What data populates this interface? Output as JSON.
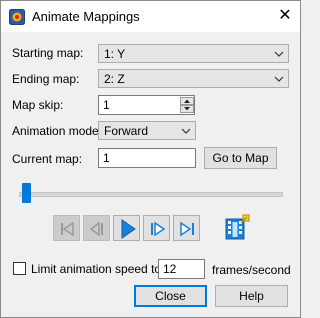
{
  "window": {
    "title": "Animate Mappings",
    "close_glyph": "✕",
    "app_icon": "tecplot-app-icon"
  },
  "form": {
    "starting_map_label": "Starting map:",
    "starting_map_value": "1: Y",
    "ending_map_label": "Ending map:",
    "ending_map_value": "2: Z",
    "map_skip_label": "Map skip:",
    "map_skip_value": "1",
    "animation_mode_label": "Animation mode:",
    "animation_mode_value": "Forward",
    "current_map_label": "Current map:",
    "current_map_value": "1",
    "go_to_map_label": "Go to Map"
  },
  "slider": {
    "position": 0
  },
  "playback": {
    "buttons": [
      "first-frame-icon",
      "step-back-icon",
      "play-icon",
      "step-forward-icon",
      "last-frame-icon"
    ],
    "export_icon": "movie-export-icon",
    "accent": "#1a7fd6",
    "disabled": "#9a9a9a"
  },
  "speed": {
    "limit_label": "Limit animation speed to",
    "limit_checked": false,
    "fps_value": "12",
    "fps_unit": "frames/second"
  },
  "footer": {
    "close_label": "Close",
    "help_label": "Help"
  }
}
